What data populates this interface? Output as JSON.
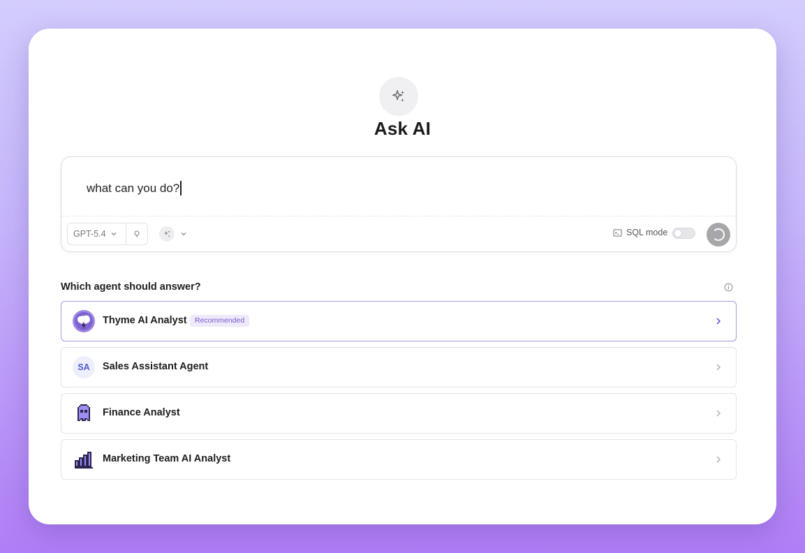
{
  "header": {
    "title": "Ask AI",
    "icon": "sparkles-icon"
  },
  "composer": {
    "prompt_value": "what can you do?",
    "model": "GPT-5.4",
    "sql_mode_label": "SQL mode",
    "sql_mode_on": false
  },
  "agents": {
    "section_label": "Which agent should answer?",
    "items": [
      {
        "name": "Thyme AI Analyst",
        "badge": "Recommended",
        "avatar": "thyme-cloud-avatar",
        "selected": true
      },
      {
        "name": "Sales Assistant Agent",
        "avatar_initials": "SA",
        "avatar": "initials-avatar",
        "selected": false
      },
      {
        "name": "Finance Analyst",
        "avatar": "pixel-ghost-avatar",
        "selected": false
      },
      {
        "name": "Marketing Team AI Analyst",
        "avatar": "bar-chart-avatar",
        "selected": false
      }
    ]
  },
  "colors": {
    "accent": "#7858c9",
    "selected_border": "#a598e6",
    "background_top": "#d3cdfd",
    "background_bottom": "#b07ef6"
  }
}
